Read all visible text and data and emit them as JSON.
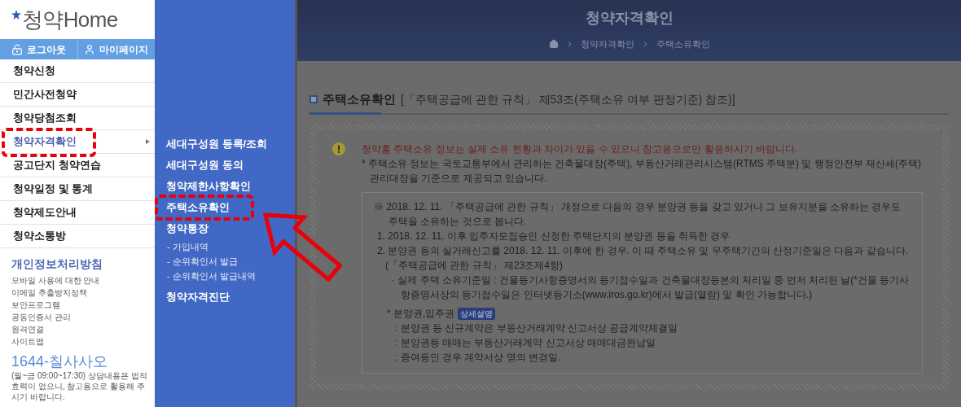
{
  "logo": {
    "text": "청약Home"
  },
  "account_buttons": [
    {
      "label": "로그아웃",
      "kind": "lock"
    },
    {
      "label": "마이페이지",
      "kind": "user"
    }
  ],
  "menu": [
    {
      "label": "청약신청",
      "selected": false
    },
    {
      "label": "민간사전청약",
      "selected": false
    },
    {
      "label": "청약당첨조회",
      "selected": false
    },
    {
      "label": "청약자격확인",
      "selected": true
    },
    {
      "label": "공고단지 청약연습",
      "selected": false
    },
    {
      "label": "청약일정 및 통계",
      "selected": false
    },
    {
      "label": "청약제도안내",
      "selected": false
    },
    {
      "label": "청약소통방",
      "selected": false
    }
  ],
  "policy": {
    "title": "개인정보처리방침",
    "links": [
      "모바일 사용에 대한 안내",
      "이메일 추출방지정책",
      "보안프로그램",
      "공동인증서 관리",
      "원격연결",
      "사이트맵"
    ]
  },
  "hotline": {
    "number": "1644-칠사사오",
    "note": "(월~금 09:00~17:30) 상담내용은 법적효력이 없으니, 참고용으로 활용해 주시기 바랍니다."
  },
  "submenu": [
    {
      "label": "세대구성원 등록/조회",
      "kind": "main"
    },
    {
      "label": "세대구성원 동의",
      "kind": "main"
    },
    {
      "label": "청약제한사항확인",
      "kind": "main"
    },
    {
      "label": "주택소유확인",
      "kind": "main"
    },
    {
      "label": "청약통장",
      "kind": "main"
    },
    {
      "label": "- 가입내역",
      "kind": "sub"
    },
    {
      "label": "- 순위확인서 발급",
      "kind": "sub"
    },
    {
      "label": "- 순위확인서 발급내역",
      "kind": "sub"
    },
    {
      "label": "청약자격진단",
      "kind": "main"
    }
  ],
  "page": {
    "title": "청약자격확인",
    "breadcrumb": [
      "청약자격확인",
      "주택소유확인"
    ]
  },
  "section": {
    "title": "주택소유확인",
    "reference": "[「주택공급에 관한 규칙」 제53조(주택소유 여부 판정기준) 참조)]"
  },
  "notice": {
    "warning": "청약홈 주택소유 정보는 실제 소유 현황과 차이가 있을 수 있으니 참고용으로만 활용하시기 바랍니다.",
    "note": "* 주택소유 정보는 국토교통부에서 관리하는 건축물대장(주택), 부동산거래관리시스템(RTMS 주택분) 및 행정안전부 재산세(주택)관리대장을 기준으로 제공되고 있습니다."
  },
  "detail": {
    "intro": "※ 2018. 12. 11. 「주택공급에 관한 규칙」 개정으로 다음의 경우 분양권 등을 갖고 있거나 그 보유지분을 소유하는 경우도 주택을 소유하는 것으로 봅니다.",
    "items": [
      "1. 2018. 12. 11. 이후 입주자모집승인 신청한 주택단지의 분양권 등을 취득한 경우",
      "2. 분양권 등의 실거래신고를 2018. 12. 11. 이후에 한 경우. 이 때 주택소유 및 무주택기간의 산정기준일은 다음과 같습니다."
    ],
    "rule_ref": "(「주택공급에 관한 규칙」 제23조제4항)",
    "criterion": "· 실제 주택 소유기준일 : 건물등기사항증명서의 등기접수일과 건축물대장등본의 처리일 중 먼저 처리된 날(*건물 등기사항증명서상의 등기접수일은 인터넷등기소(www.iros.go.kr)에서 발급(열람) 및 확인 가능합니다.)",
    "rights_label": "* 분양권,입주권",
    "badge": "상세설명",
    "rights_items": [
      ": 분양권 등 신규계약은 부동산거래계약 신고서상 공급계약체결일",
      ": 분양권등 매매는 부동산거래계약 신고서상 매매대금완납일",
      ": 증여등인 경우 계약서상 명의 변경일."
    ]
  }
}
